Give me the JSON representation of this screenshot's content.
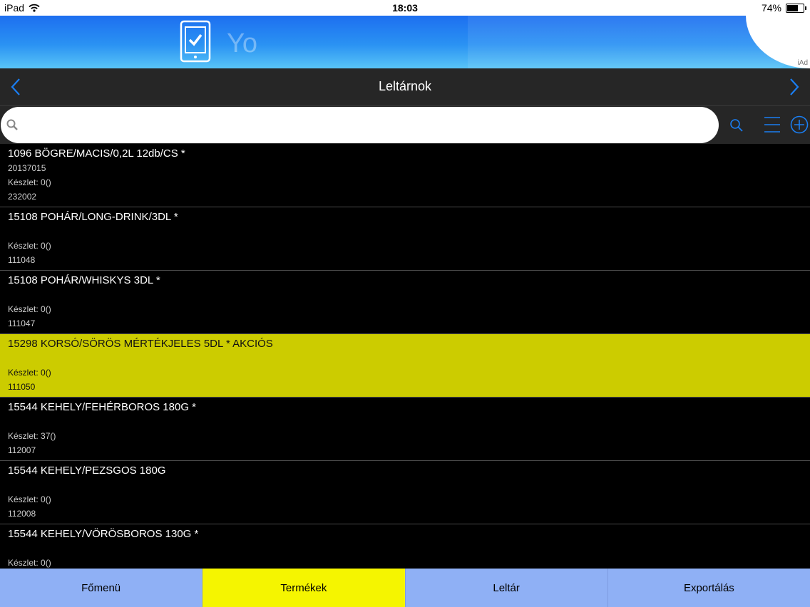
{
  "status_bar": {
    "device": "iPad",
    "time": "18:03",
    "battery_percent": "74%",
    "battery_level": 0.74
  },
  "ad_banner": {
    "partial_text": "Yo",
    "iad_label": "iAd"
  },
  "nav": {
    "title": "Leltárnok",
    "back_icon": "chevron-left-icon",
    "forward_icon": "chevron-right-icon"
  },
  "search": {
    "placeholder": "",
    "value": ""
  },
  "products": [
    {
      "title": "1096 BÖGRE/MACIS/0,2L 12db/CS *",
      "code": "20137015",
      "stock": "Készlet: 0()",
      "id": "232002",
      "highlighted": false
    },
    {
      "title": "15108 POHÁR/LONG-DRINK/3DL *",
      "code": "",
      "stock": "Készlet: 0()",
      "id": "111048",
      "highlighted": false
    },
    {
      "title": "15108 POHÁR/WHISKYS 3DL *",
      "code": "",
      "stock": "Készlet: 0()",
      "id": "111047",
      "highlighted": false
    },
    {
      "title": "15298 KORSÓ/SÖRÖS MÉRTÉKJELES 5DL * AKCIÓS",
      "code": "",
      "stock": "Készlet: 0()",
      "id": "111050",
      "highlighted": true
    },
    {
      "title": "15544 KEHELY/FEHÉRBOROS 180G *",
      "code": "",
      "stock": "Készlet: 37()",
      "id": "112007",
      "highlighted": false
    },
    {
      "title": "15544 KEHELY/PEZSGOS 180G",
      "code": "",
      "stock": "Készlet: 0()",
      "id": "112008",
      "highlighted": false
    },
    {
      "title": "15544 KEHELY/VÖRÖSBOROS 130G *",
      "code": "",
      "stock": "Készlet: 0()",
      "id": "",
      "highlighted": false
    }
  ],
  "tabs": [
    {
      "label": "Főmenü",
      "active": false
    },
    {
      "label": "Termékek",
      "active": true
    },
    {
      "label": "Leltár",
      "active": false
    },
    {
      "label": "Exportálás",
      "active": false
    }
  ],
  "colors": {
    "highlight": "#cccc00",
    "tab_active": "#f5f500",
    "tab_inactive": "#8fb0f5",
    "accent_blue": "#1a7ef2"
  }
}
